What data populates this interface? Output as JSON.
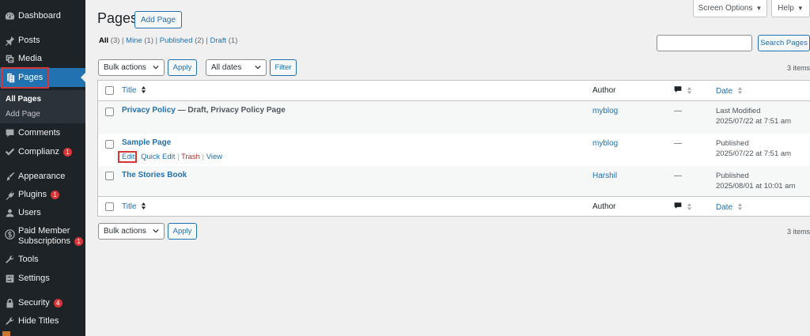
{
  "sidebar": {
    "items": [
      {
        "key": "dashboard",
        "label": "Dashboard",
        "icon": "dashboard-icon"
      },
      {
        "key": "posts",
        "label": "Posts",
        "icon": "pin-icon"
      },
      {
        "key": "media",
        "label": "Media",
        "icon": "media-icon"
      },
      {
        "key": "pages",
        "label": "Pages",
        "icon": "pages-icon"
      },
      {
        "key": "comments",
        "label": "Comments",
        "icon": "comment-icon"
      },
      {
        "key": "complianz",
        "label": "Complianz",
        "icon": "check-icon",
        "badge": "1"
      },
      {
        "key": "appearance",
        "label": "Appearance",
        "icon": "brush-icon"
      },
      {
        "key": "plugins",
        "label": "Plugins",
        "icon": "plug-icon",
        "badge": "1"
      },
      {
        "key": "users",
        "label": "Users",
        "icon": "user-icon"
      },
      {
        "key": "paid_member",
        "label": "Paid Member",
        "label2": "Subscriptions",
        "icon": "dollar-icon",
        "badge": "1"
      },
      {
        "key": "tools",
        "label": "Tools",
        "icon": "wrench-icon"
      },
      {
        "key": "settings",
        "label": "Settings",
        "icon": "settings-icon"
      },
      {
        "key": "security",
        "label": "Security",
        "icon": "lock-icon",
        "badge": "4"
      },
      {
        "key": "hide_titles",
        "label": "Hide Titles",
        "icon": "tool-icon"
      }
    ],
    "submenu": {
      "all_pages": "All Pages",
      "add_page": "Add Page"
    }
  },
  "header": {
    "screen_options": "Screen Options",
    "help": "Help",
    "title": "Pages",
    "add_page": "Add Page"
  },
  "filters": {
    "all": "All",
    "all_count": "(3)",
    "mine": "Mine",
    "mine_count": "(1)",
    "published": "Published",
    "published_count": "(2)",
    "draft": "Draft",
    "draft_count": "(1)",
    "search_placeholder": "",
    "search_button": "Search Pages"
  },
  "tablenav": {
    "bulk_actions": "Bulk actions",
    "apply": "Apply",
    "all_dates": "All dates",
    "filter": "Filter",
    "items_count": "3 items"
  },
  "table": {
    "columns": {
      "title": "Title",
      "author": "Author",
      "date": "Date"
    },
    "rows": [
      {
        "title": "Privacy Policy",
        "state": " — Draft, Privacy Policy Page",
        "author": "myblog",
        "comments": "—",
        "status": "Last Modified",
        "date": "2025/07/22 at 7:51 am"
      },
      {
        "title": "Sample Page",
        "state": "",
        "author": "myblog",
        "comments": "—",
        "status": "Published",
        "date": "2025/07/22 at 7:51 am",
        "actions": {
          "edit": "Edit",
          "quick_edit": "Quick Edit",
          "trash": "Trash",
          "view": "View",
          "sep": "|"
        }
      },
      {
        "title": "The Stories Book",
        "state": "",
        "author": "Harshil",
        "comments": "—",
        "status": "Published",
        "date": "2025/08/01 at 10:01 am"
      }
    ]
  },
  "colors": {
    "sidebar_bg": "#1d2327",
    "accent": "#2271b1",
    "highlight_box": "#d63638"
  }
}
